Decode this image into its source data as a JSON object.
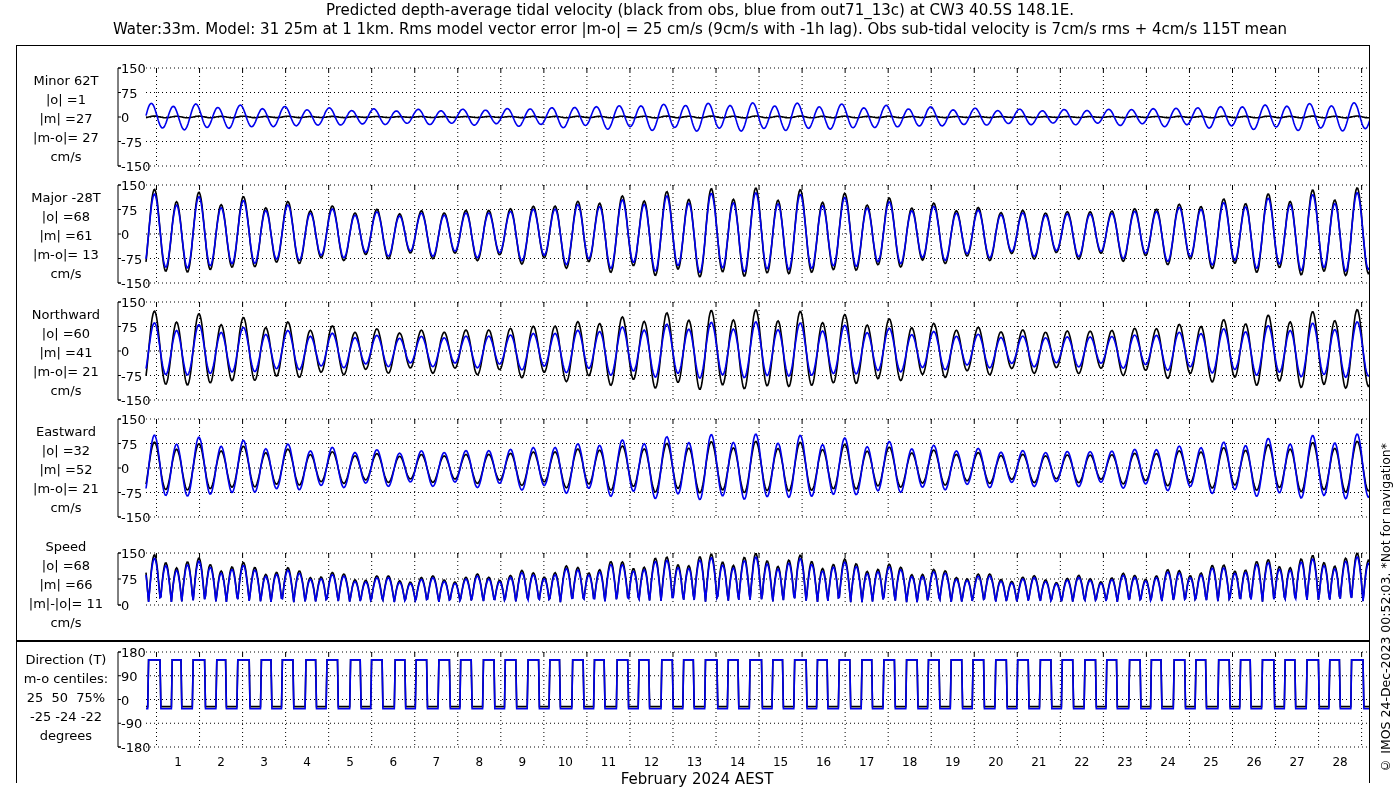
{
  "title_lines": [
    "Predicted depth-average tidal velocity (black from obs, blue from out71_13c) at CW3 40.5S 148.1E.",
    "Water:33m. Model: 31 25m at 1 1km. Rms model vector error |m-o| = 25 cm/s (9cm/s with -1h lag). Obs sub-tidal velocity is 7cm/s rms + 4cm/s 115T mean"
  ],
  "panels": [
    {
      "kind": "minor",
      "label_lines": [
        "Minor 62T",
        "|o| =1",
        "|m| =27",
        "|m-o|= 27",
        "cm/s"
      ],
      "yticks": [
        "150",
        "75",
        "0",
        "-75",
        "-150"
      ]
    },
    {
      "kind": "major",
      "label_lines": [
        "Major -28T",
        "|o| =68",
        "|m| =61",
        "|m-o|= 13",
        "cm/s"
      ],
      "yticks": [
        "150",
        "75",
        "0",
        "-75",
        "-150"
      ]
    },
    {
      "kind": "northward",
      "label_lines": [
        "Northward",
        "|o| =60",
        "|m| =41",
        "|m-o|= 21",
        "cm/s"
      ],
      "yticks": [
        "150",
        "75",
        "0",
        "-75",
        "-150"
      ]
    },
    {
      "kind": "eastward",
      "label_lines": [
        "Eastward",
        "|o| =32",
        "|m| =52",
        "|m-o|= 21",
        "cm/s"
      ],
      "yticks": [
        "150",
        "75",
        "0",
        "-75",
        "-150"
      ]
    },
    {
      "kind": "speed",
      "label_lines": [
        "Speed",
        "|o| =68",
        "|m| =66",
        "|m|-|o|= 11",
        "cm/s"
      ],
      "yticks": [
        "150",
        "75",
        "0"
      ]
    },
    {
      "kind": "direction",
      "label_lines": [
        "Direction (T)",
        "m-o centiles:",
        "25  50  75%",
        "-25 -24 -22",
        "degrees"
      ],
      "yticks": [
        "180",
        "90",
        "0",
        "-90",
        "-180"
      ]
    }
  ],
  "x_axis": {
    "ticks": [
      "1",
      "2",
      "3",
      "4",
      "5",
      "6",
      "7",
      "8",
      "9",
      "10",
      "11",
      "12",
      "13",
      "14",
      "15",
      "16",
      "17",
      "18",
      "19",
      "20",
      "21",
      "22",
      "23",
      "24",
      "25",
      "26",
      "27",
      "28"
    ],
    "label": "February 2024 AEST"
  },
  "footer": "© IMOS 24-Dec-2023 00:52:03. *Not for navigation*"
}
